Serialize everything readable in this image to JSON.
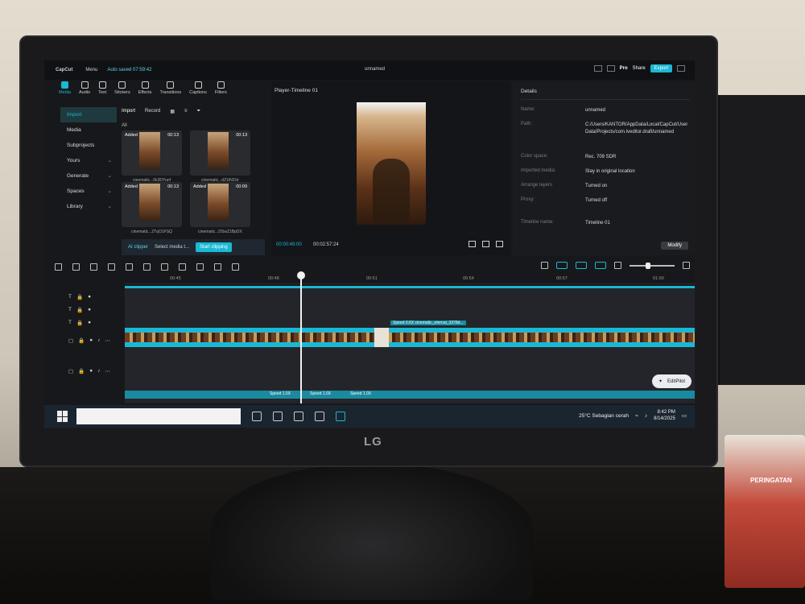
{
  "app": {
    "brand": "CapCut",
    "menu": "Menu",
    "autosave": "Auto saved 07:59:42",
    "project_name": "unnamed",
    "pro": "Pro",
    "share": "Share",
    "export": "Export"
  },
  "tools": [
    "Media",
    "Audio",
    "Text",
    "Stickers",
    "Effects",
    "Transitions",
    "Captions",
    "Filters"
  ],
  "leftnav": [
    "Import",
    "Media",
    "Subprojects",
    "Yours",
    "Generate",
    "Spaces",
    "Library"
  ],
  "media": {
    "import": "Import",
    "record": "Record",
    "all": "All",
    "clips": [
      {
        "added": "Added",
        "duration": "00:13",
        "name": "cinematic...0k3DYunf"
      },
      {
        "added": "Added",
        "duration": "00:13",
        "name": "cinematic...dZ1tN2Ur"
      },
      {
        "added": "Added",
        "duration": "00:13",
        "name": "cinematic...2TqO1FSQ"
      },
      {
        "added": "Added",
        "duration": "00:09",
        "name": "cinematic...DSwZ1BpDX"
      }
    ]
  },
  "clipper": {
    "label": "AI clipper",
    "select": "Select media t...",
    "start": "Start clipping"
  },
  "player": {
    "title": "Player-Timeline 01",
    "current_time": "00:00:49:00",
    "total_time": "00:02:57:24"
  },
  "details": {
    "title": "Details",
    "rows": [
      {
        "key": "Name:",
        "value": "unnamed"
      },
      {
        "key": "Path:",
        "value": "C:/Users/KANTOR/AppData/Local/CapCut/User Data/Projects/com.lveditor.draft/unnamed"
      },
      {
        "key": "Color space:",
        "value": "Rec. 709 SDR"
      },
      {
        "key": "Imported media:",
        "value": "Stay in original location"
      },
      {
        "key": "Arrange layers",
        "value": "Turned on"
      },
      {
        "key": "Proxy:",
        "value": "Turned off"
      },
      {
        "key": "Timeline name:",
        "value": "Timeline 01"
      }
    ],
    "modify": "Modify"
  },
  "ruler": [
    "00:45",
    "00:48",
    "00:51",
    "00:54",
    "00:57",
    "01:00"
  ],
  "timeline": {
    "clip_label": "Speed 0.6X  cinematic_eternal_3378d...",
    "audio_labels": [
      "Speed 1.0X",
      "Speed 1.0X",
      "Speed 1.0X"
    ],
    "editpilot": "EditPilot"
  },
  "taskbar": {
    "weather": "25°C  Sebagian cerah",
    "time": "8:42 PM",
    "date": "8/14/2025"
  },
  "monitor_brand": "LG",
  "colors": {
    "accent": "#1ab8d4",
    "bg": "#17181b"
  }
}
